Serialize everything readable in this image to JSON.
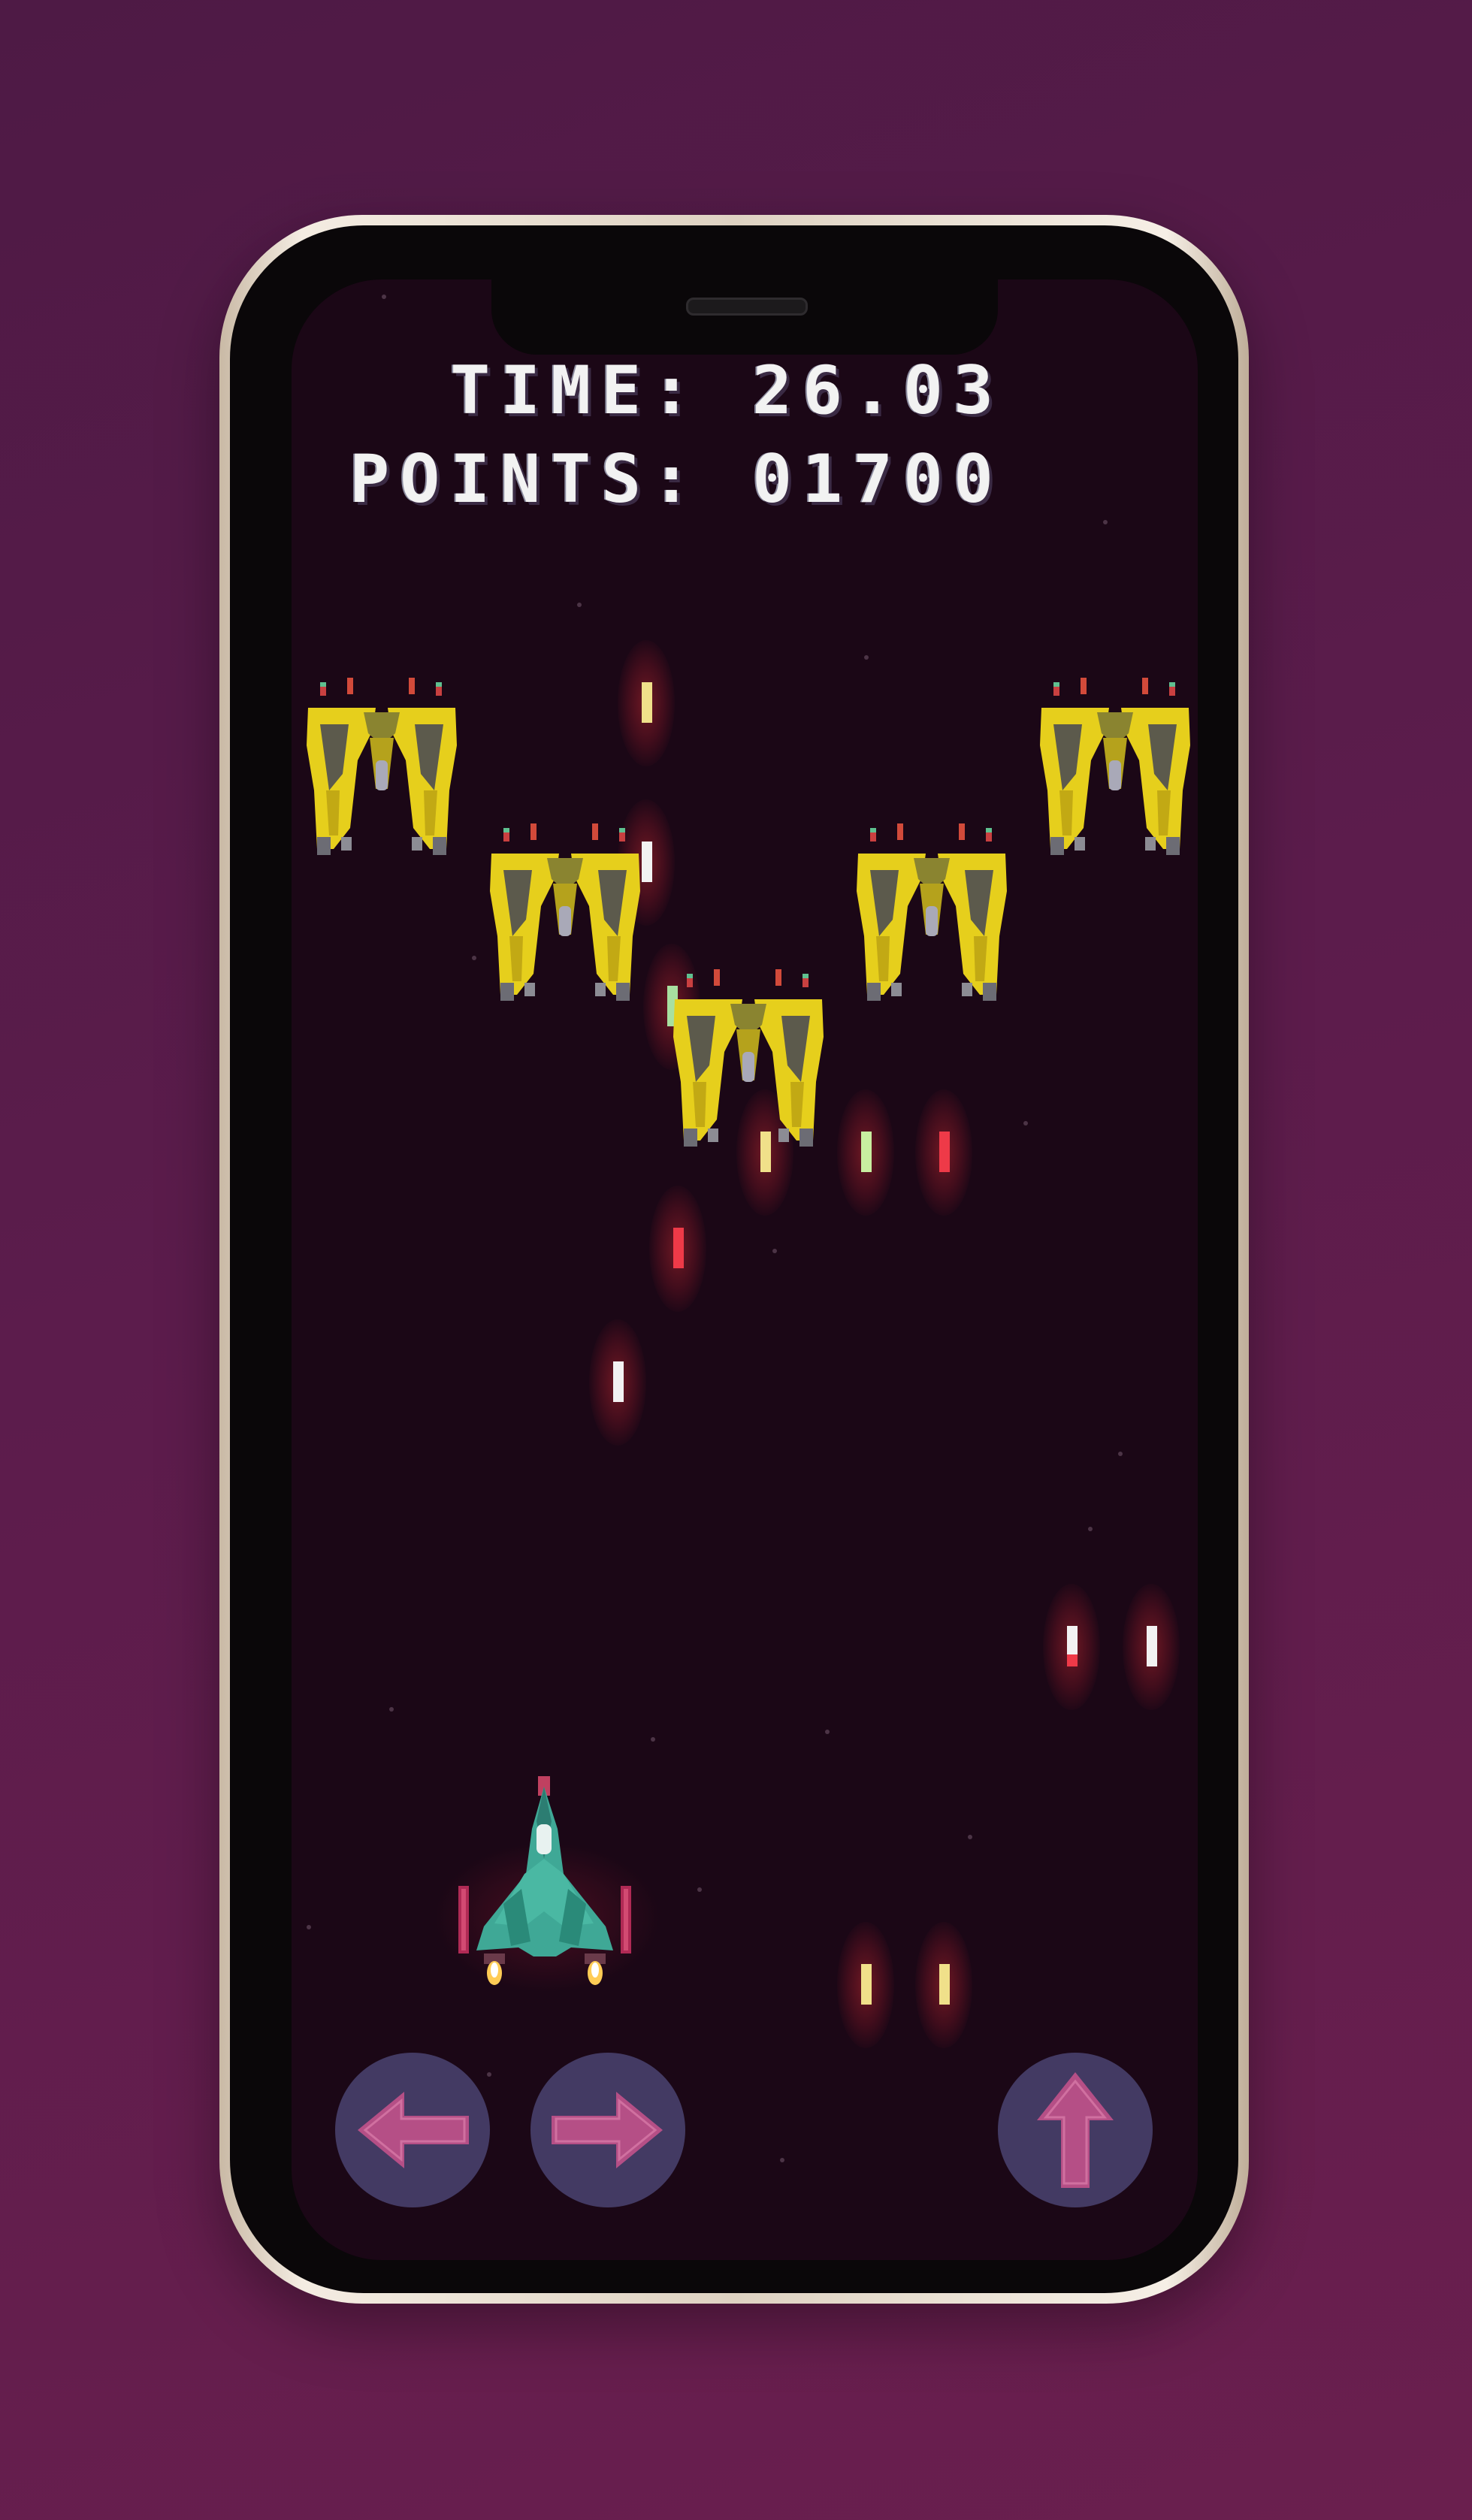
{
  "hud": {
    "time_label": "TIME:",
    "time_value": "26.03",
    "points_label": "POINTS:",
    "points_value": "01700"
  },
  "controls": {
    "left": "move-left",
    "right": "move-right",
    "fire": "fire-up"
  },
  "colors": {
    "background": "#5c1c4c",
    "screen": "#1b0716",
    "enemy_body": "#e6cf1c",
    "player_body": "#3fa896",
    "control_button": "#433a63",
    "control_arrow": "#b54f86"
  }
}
